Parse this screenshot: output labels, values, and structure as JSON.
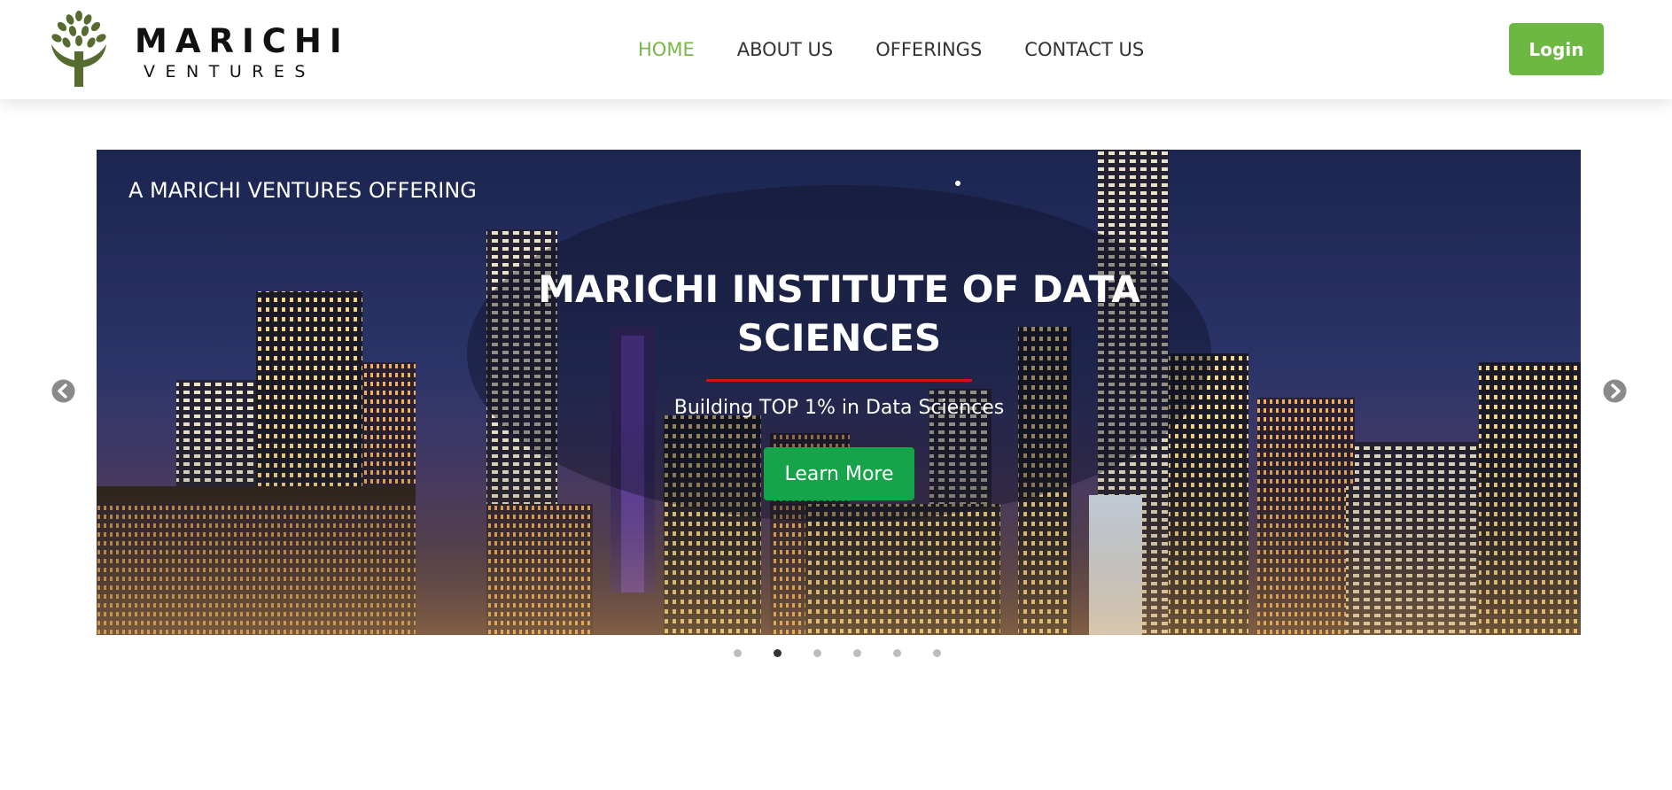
{
  "brand": {
    "name": "MARICHI",
    "sub": "VENTURES",
    "logo_icon": "tree-hands-logo",
    "logo_color": "#556b2f"
  },
  "nav": {
    "items": [
      {
        "label": "HOME",
        "active": true
      },
      {
        "label": "ABOUT US",
        "active": false
      },
      {
        "label": "OFFERINGS",
        "active": false
      },
      {
        "label": "CONTACT US",
        "active": false
      }
    ],
    "active_color": "#7ab648",
    "login_label": "Login",
    "login_color": "#6cb843"
  },
  "slider": {
    "tagline": "A MARICHI VENTURES OFFERING",
    "title": "MARICHI INSTITUTE OF DATA SCIENCES",
    "subtitle": "Building TOP 1% in Data Sciences",
    "cta_label": "Learn More",
    "cta_color": "#16a34a",
    "accent_rule_color": "#d0121a",
    "background": "night city skyline",
    "prev_icon": "chevron-left-circle-icon",
    "next_icon": "chevron-right-circle-icon",
    "slide_count": 6,
    "active_slide": 2
  }
}
